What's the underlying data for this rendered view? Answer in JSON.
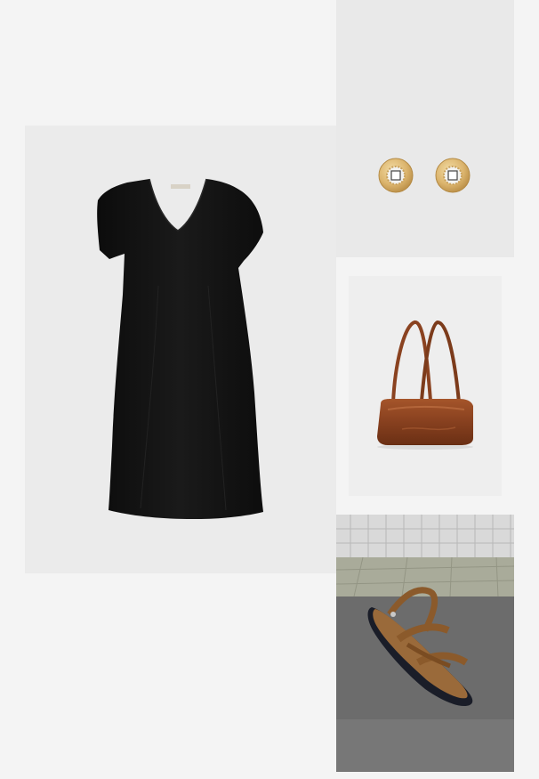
{
  "outfit": {
    "items": [
      {
        "key": "dress",
        "icon": "black-dress-image",
        "color": "#141414"
      },
      {
        "key": "earrings",
        "icon": "gold-stud-earrings-image",
        "color": "#d9b472"
      },
      {
        "key": "bag",
        "icon": "brown-leather-shoulder-bag-image",
        "color": "#8a4220"
      },
      {
        "key": "sandal",
        "icon": "brown-strappy-sandal-image",
        "color": "#8b5a2b"
      }
    ]
  }
}
